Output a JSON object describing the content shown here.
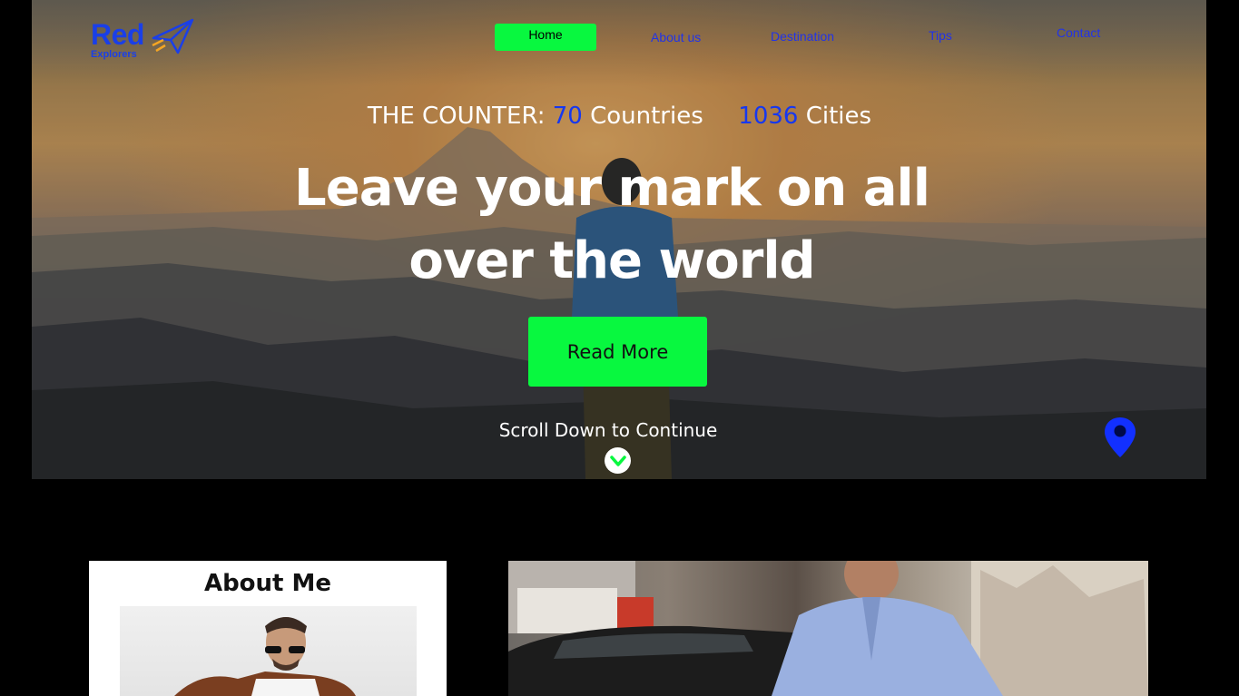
{
  "brand": {
    "name": "Red",
    "tagline": "Explorers",
    "color": "#1a3fe8"
  },
  "nav": {
    "items": [
      {
        "label": "Home",
        "active": true
      },
      {
        "label": "About us"
      },
      {
        "label": "Destination"
      },
      {
        "label": "Tips"
      },
      {
        "label": "Contact"
      }
    ]
  },
  "hero": {
    "counter_prefix": "THE COUNTER:",
    "countries_num": "70",
    "countries_label": "Countries",
    "cities_num": "1036",
    "cities_label": "Cities",
    "headline_line1": "Leave your mark on all",
    "headline_line2": "over the world",
    "cta_label": "Read More",
    "scroll_text": "Scroll Down to Continue",
    "scroll_icon": "chevron-down-icon",
    "location_icon": "map-pin-icon"
  },
  "about": {
    "title": "About Me"
  },
  "colors": {
    "accent_green": "#08f83f",
    "accent_blue": "#1638f0",
    "background": "#000000"
  }
}
